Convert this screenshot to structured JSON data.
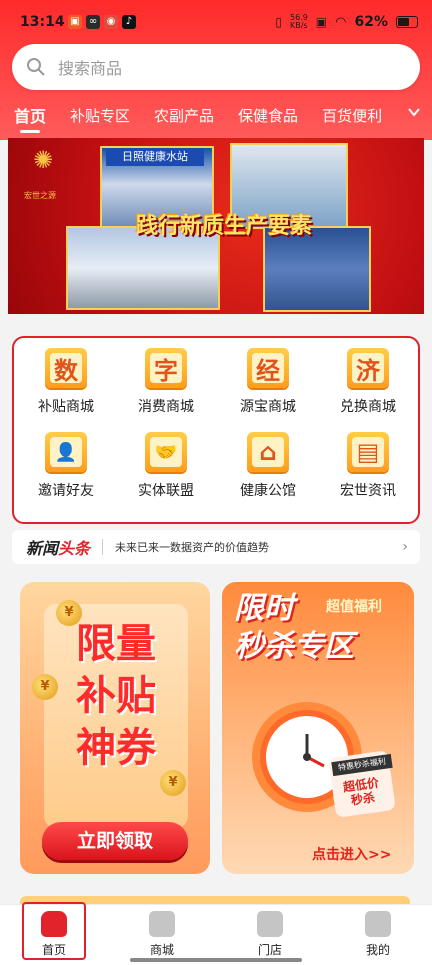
{
  "status_bar": {
    "time": "13:14",
    "net_speed": "56.9\nKB/s",
    "battery": "62%"
  },
  "search": {
    "placeholder": "搜索商品"
  },
  "tabs": [
    {
      "label": "首页",
      "active": true
    },
    {
      "label": "补贴专区"
    },
    {
      "label": "农副产品"
    },
    {
      "label": "保健食品"
    },
    {
      "label": "百货便利"
    }
  ],
  "banner": {
    "headline": "践行新质生产要素",
    "sign_text": "日照健康水站",
    "logo_text": "宏世之源"
  },
  "grid_menu": [
    {
      "icon_char": "数",
      "label": "补贴商城"
    },
    {
      "icon_char": "字",
      "label": "消费商城"
    },
    {
      "icon_char": "经",
      "label": "源宝商城"
    },
    {
      "icon_char": "济",
      "label": "兑换商城"
    },
    {
      "icon_char": "👤",
      "label": "邀请好友"
    },
    {
      "icon_char": "🤝",
      "label": "实体联盟"
    },
    {
      "icon_char": "⌂",
      "label": "健康公馆"
    },
    {
      "icon_char": "▤",
      "label": "宏世资讯"
    }
  ],
  "news": {
    "brand_left": "新闻",
    "brand_right": "头条",
    "text": "未来已来一数据资产的价值趋势"
  },
  "promo_left": {
    "line1": "限量",
    "line2": "补贴",
    "line3": "神券",
    "button": "立即领取",
    "coin": "¥"
  },
  "promo_right": {
    "title1": "限时",
    "title2": "秒杀专区",
    "tag": "超值福利",
    "label1": "特惠秒杀福利",
    "label2": "超低价\n秒杀",
    "enter": "点击进入>>"
  },
  "bottom_nav": [
    {
      "label": "首页",
      "active": true
    },
    {
      "label": "商城"
    },
    {
      "label": "门店"
    },
    {
      "label": "我的"
    }
  ],
  "colors": {
    "brand_red": "#e3232b",
    "accent_orange": "#ff9d1a"
  }
}
